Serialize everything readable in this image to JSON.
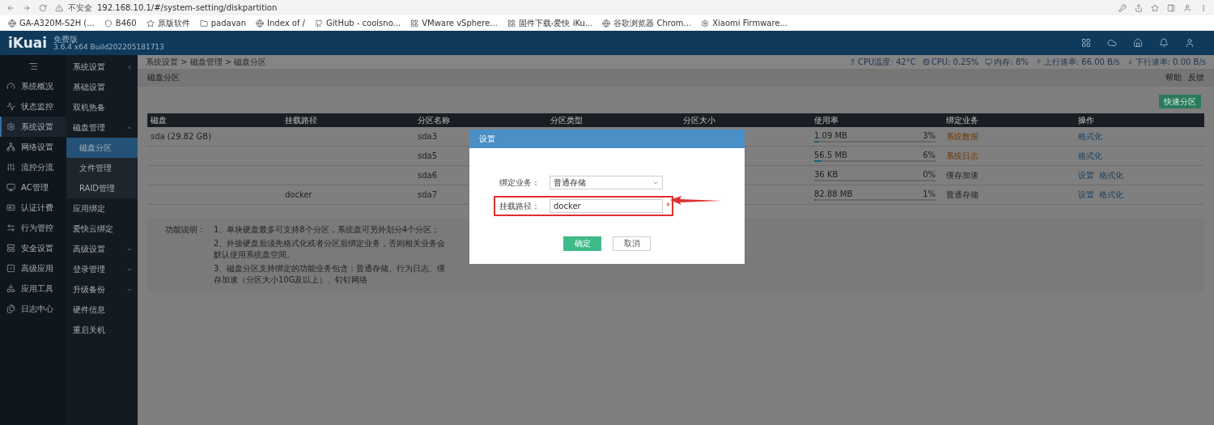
{
  "browser": {
    "security": "不安全",
    "url": "192.168.10.1/#/system-setting/diskpartition",
    "bookmarks": [
      {
        "label": "GA-A320M-S2H (..."
      },
      {
        "label": "B460"
      },
      {
        "label": "原版软件"
      },
      {
        "label": "padavan"
      },
      {
        "label": "Index of /"
      },
      {
        "label": "GitHub - coolsno..."
      },
      {
        "label": "VMware vSphere..."
      },
      {
        "label": "固件下载-爱快 iKu..."
      },
      {
        "label": "谷歌浏览器 Chrom..."
      },
      {
        "label": "Xiaomi Firmware..."
      }
    ]
  },
  "header": {
    "logo": "iKuai",
    "edition": "免费版",
    "version": "3.6.4 x64 Build202205181713"
  },
  "sidebar": {
    "items": [
      {
        "label": "系统概况",
        "selected": false
      },
      {
        "label": "状态监控",
        "selected": false
      },
      {
        "label": "系统设置",
        "selected": true
      },
      {
        "label": "网络设置",
        "selected": false
      },
      {
        "label": "流控分流",
        "selected": false
      },
      {
        "label": "AC管理",
        "selected": false
      },
      {
        "label": "认证计费",
        "selected": false
      },
      {
        "label": "行为管控",
        "selected": false
      },
      {
        "label": "安全设置",
        "selected": false
      },
      {
        "label": "高级应用",
        "selected": false
      },
      {
        "label": "应用工具",
        "selected": false
      },
      {
        "label": "日志中心",
        "selected": false
      }
    ]
  },
  "submenu": {
    "title": "系统设置",
    "items": [
      {
        "label": "基础设置",
        "selected": false
      },
      {
        "label": "双机热备",
        "selected": false
      },
      {
        "label": "磁盘管理",
        "selected": false,
        "expanded": true,
        "children": [
          {
            "label": "磁盘分区",
            "selected": true
          },
          {
            "label": "文件管理",
            "selected": false
          },
          {
            "label": "RAID管理",
            "selected": false
          }
        ]
      },
      {
        "label": "应用绑定",
        "selected": false
      },
      {
        "label": "爱快云绑定",
        "selected": false
      },
      {
        "label": "高级设置",
        "selected": false,
        "expanded": false
      },
      {
        "label": "登录管理",
        "selected": false,
        "expanded": false
      },
      {
        "label": "升级备份",
        "selected": false,
        "expanded": false
      },
      {
        "label": "硬件信息",
        "selected": false
      },
      {
        "label": "重启关机",
        "selected": false
      }
    ]
  },
  "breadcrumb": "系统设置 > 磁盘管理 > 磁盘分区",
  "stats": {
    "cpu_temp": "CPU温度: 42°C",
    "cpu": "CPU: 0.25%",
    "memory": "内存: 8%",
    "upload": "上行速率: 66.00 B/s",
    "download": "下行速率: 0.00 B/s"
  },
  "page": {
    "title": "磁盘分区",
    "help": "帮助",
    "feedback": "反馈",
    "quick_button": "快速分区"
  },
  "table": {
    "columns": [
      "磁盘",
      "挂载路径",
      "分区名称",
      "分区类型",
      "分区大小",
      "使用率",
      "绑定业务",
      "操作"
    ],
    "rows": [
      {
        "disk": "sda (29.82 GB)",
        "mount": "",
        "name": "sda3",
        "used": "1.09 MB",
        "percent": "3%",
        "level": 0.03,
        "service": "系统数据",
        "kind": "system",
        "actions": [
          "格式化"
        ]
      },
      {
        "disk": "",
        "mount": "",
        "name": "sda5",
        "used": "56.5 MB",
        "percent": "6%",
        "level": 0.06,
        "service": "系统日志",
        "kind": "system",
        "actions": [
          "格式化"
        ]
      },
      {
        "disk": "",
        "mount": "",
        "name": "sda6",
        "used": "36 KB",
        "percent": "0%",
        "level": 0,
        "service": "缓存加速",
        "kind": "user",
        "actions": [
          "设置",
          "格式化"
        ]
      },
      {
        "disk": "",
        "mount": "docker",
        "name": "sda7",
        "used": "82.88 MB",
        "percent": "1%",
        "level": 0.01,
        "service": "普通存储",
        "kind": "user",
        "actions": [
          "设置",
          "格式化"
        ]
      }
    ]
  },
  "notes": {
    "label": "功能说明：",
    "lines": [
      "1、单块硬盘最多可支持8个分区，系统盘可另外划分4个分区；",
      "2、外接硬盘后须先格式化或者分区后绑定业务，否则相关业务会默认使用系统盘空间。",
      "3、磁盘分区支持绑定的功能业务包含：普通存储、行为日志、缓存加速（分区大小10G及以上）、钉钉网络"
    ]
  },
  "dialog": {
    "title": "设置",
    "fields": [
      {
        "kind": "select",
        "label": "绑定业务：",
        "value": "普通存储",
        "highlighted": false
      },
      {
        "kind": "input",
        "label": "挂载路径：",
        "value": "docker",
        "required_mark": "*",
        "highlighted": true
      }
    ],
    "ok": "确定",
    "cancel": "取消"
  }
}
